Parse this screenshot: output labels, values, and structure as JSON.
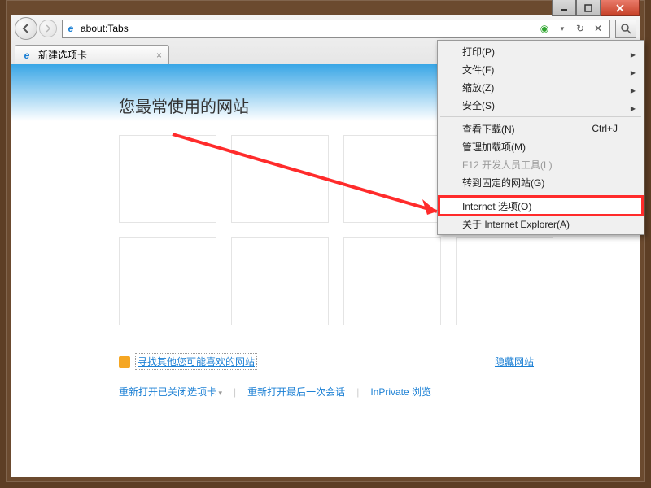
{
  "window": {
    "address": "about:Tabs",
    "tab_title": "新建选项卡"
  },
  "page": {
    "heading": "您最常使用的网站",
    "suggest_link": "寻找其他您可能喜欢的网站",
    "hide_sites": "隐藏网站",
    "footer": {
      "reopen_closed": "重新打开已关闭选项卡",
      "reopen_last": "重新打开最后一次会话",
      "inprivate": "InPrivate 浏览"
    }
  },
  "menu": {
    "print": "打印(P)",
    "file": "文件(F)",
    "zoom": "缩放(Z)",
    "safety": "安全(S)",
    "view_downloads": "查看下载(N)",
    "view_downloads_shortcut": "Ctrl+J",
    "manage_addons": "管理加载项(M)",
    "f12": "F12 开发人员工具(L)",
    "goto_pinned": "转到固定的网站(G)",
    "internet_options": "Internet 选项(O)",
    "about_ie": "关于 Internet Explorer(A)"
  }
}
